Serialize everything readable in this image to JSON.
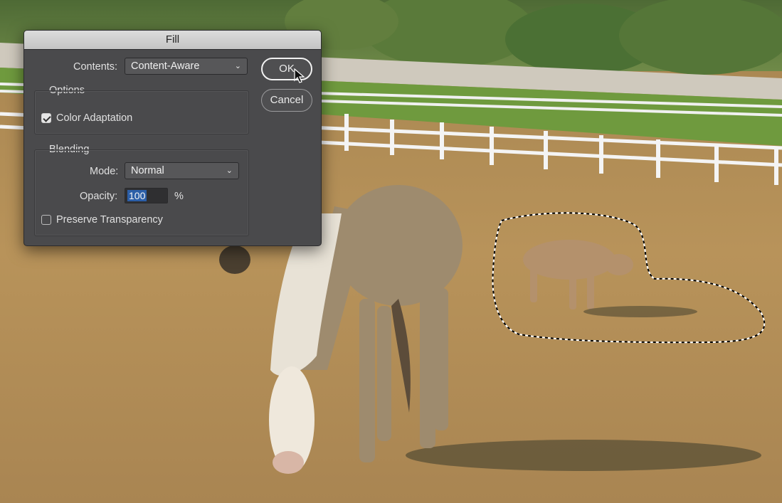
{
  "dialog": {
    "title": "Fill",
    "contents_label": "Contents:",
    "contents_value": "Content-Aware",
    "ok_label": "OK",
    "cancel_label": "Cancel",
    "options": {
      "legend": "Options",
      "color_adaptation_label": "Color Adaptation",
      "color_adaptation_checked": true
    },
    "blending": {
      "legend": "Blending",
      "mode_label": "Mode:",
      "mode_value": "Normal",
      "opacity_label": "Opacity:",
      "opacity_value": "100",
      "opacity_unit": "%",
      "preserve_transparency_label": "Preserve Transparency",
      "preserve_transparency_checked": false
    }
  },
  "icons": [
    "chevron-down-icon",
    "checkmark-icon",
    "mouse-pointer-icon"
  ],
  "colors": {
    "dialog_bg": "#4a4a4c",
    "titlebar_bg": "#cfcfcf",
    "selection_blue": "#2c5fa8",
    "grass": "#b8955e",
    "fence": "#f2f2f2"
  }
}
